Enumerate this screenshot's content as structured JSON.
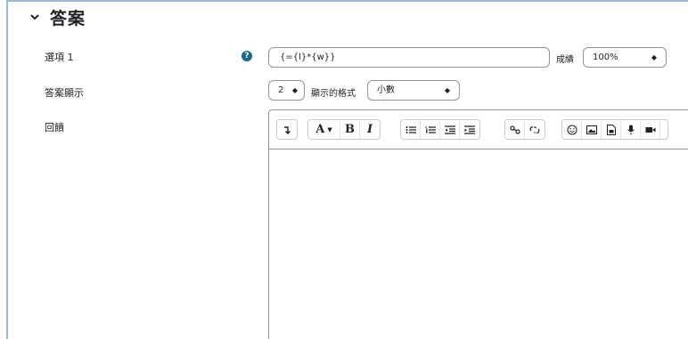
{
  "section": {
    "title": "答案",
    "icon": "chevron-down-icon"
  },
  "answer": {
    "label": "選項 1",
    "help_icon": "question-circle-icon",
    "formula_value": "{={l}*{w}}",
    "grade_label": "成績",
    "grade_value": "100%"
  },
  "display": {
    "label": "答案顯示",
    "decimals_value": "2",
    "format_label": "顯示的格式",
    "format_value": "小數"
  },
  "feedback": {
    "label": "回饋"
  },
  "toolbar": {
    "buttons": [
      "show-more-icon",
      "font-color-icon",
      "bold-icon",
      "italic-icon",
      "unordered-list-icon",
      "ordered-list-icon",
      "outdent-icon",
      "indent-icon",
      "link-icon",
      "unlink-icon",
      "emoji-icon",
      "image-icon",
      "media-icon",
      "record-audio-icon",
      "record-video-icon"
    ],
    "bold_label": "B",
    "italic_label": "I",
    "font_color_label": "A"
  }
}
